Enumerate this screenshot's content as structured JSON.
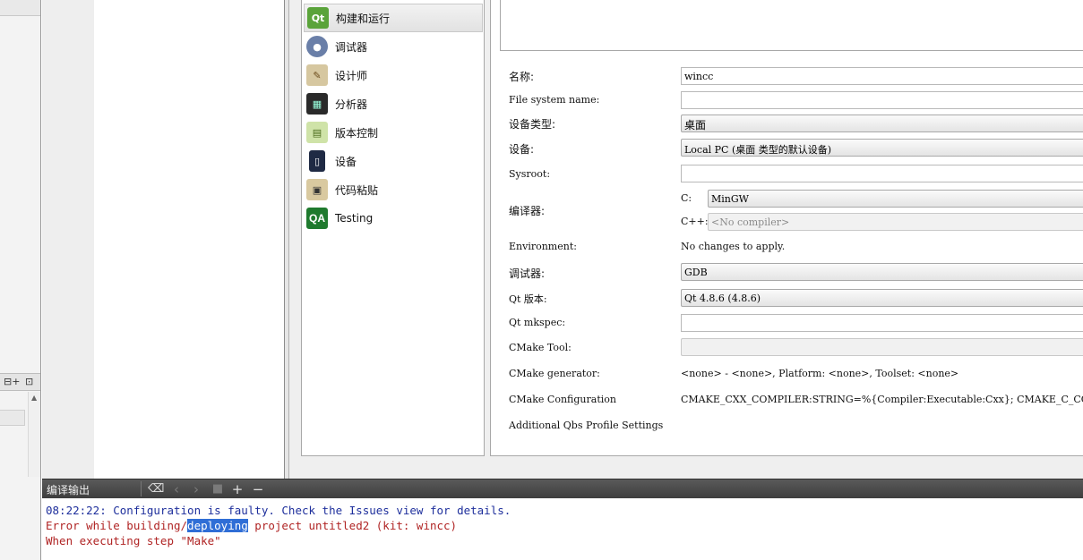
{
  "categories": [
    {
      "label": "构建和运行",
      "icon": "qt-build-run-icon",
      "selected": true
    },
    {
      "label": "调试器",
      "icon": "debugger-bug-icon",
      "selected": false
    },
    {
      "label": "设计师",
      "icon": "designer-pencil-icon",
      "selected": false
    },
    {
      "label": "分析器",
      "icon": "analyzer-icon",
      "selected": false
    },
    {
      "label": "版本控制",
      "icon": "version-control-icon",
      "selected": false
    },
    {
      "label": "设备",
      "icon": "device-phone-icon",
      "selected": false
    },
    {
      "label": "代码粘贴",
      "icon": "code-paste-icon",
      "selected": false
    },
    {
      "label": "Testing",
      "icon": "qa-testing-icon",
      "selected": false
    }
  ],
  "kit_form": {
    "name_label": "名称:",
    "name_value": "wincc",
    "fs_label": "File system name:",
    "fs_value": "",
    "device_type_label": "设备类型:",
    "device_type_value": "桌面",
    "device_label": "设备:",
    "device_value": "Local PC (桌面 类型的默认设备)",
    "sysroot_label": "Sysroot:",
    "sysroot_value": "",
    "compiler_label": "编译器:",
    "compiler_c_label": "C:",
    "compiler_c_value": "MinGW",
    "compiler_cpp_label": "C++:",
    "compiler_cpp_value": "<No compiler>",
    "environment_label": "Environment:",
    "environment_value": "No changes to apply.",
    "debugger_label": "调试器:",
    "debugger_value": "GDB",
    "qt_version_label": "Qt 版本:",
    "qt_version_value": "Qt 4.8.6 (4.8.6)",
    "mkspec_label": "Qt mkspec:",
    "mkspec_value": "",
    "cmake_tool_label": "CMake Tool:",
    "cmake_tool_value": "",
    "cmake_generator_label": "CMake generator:",
    "cmake_generator_value": "<none> - <none>, Platform: <none>, Toolset: <none>",
    "cmake_config_label": "CMake Configuration",
    "cmake_config_value": "CMAKE_CXX_COMPILER:STRING=%{Compiler:Executable:Cxx}; CMAKE_C_COMPILER:STRING=%{Compiler:Executable:C}",
    "qbs_label": "Additional Qbs Profile Settings"
  },
  "output": {
    "title": "编译输出",
    "line1": "08:22:22: Configuration is faulty. Check the Issues view for details.",
    "line2_pre": "Error while building/",
    "line2_hl": "deploying",
    "line2_post": " project untitled2 (kit: wincc)",
    "line3": "When executing step \"Make\""
  },
  "colors": {
    "info_blue": "#1e2f9c",
    "error_red": "#b02424",
    "selection": "#2f6ed6"
  }
}
